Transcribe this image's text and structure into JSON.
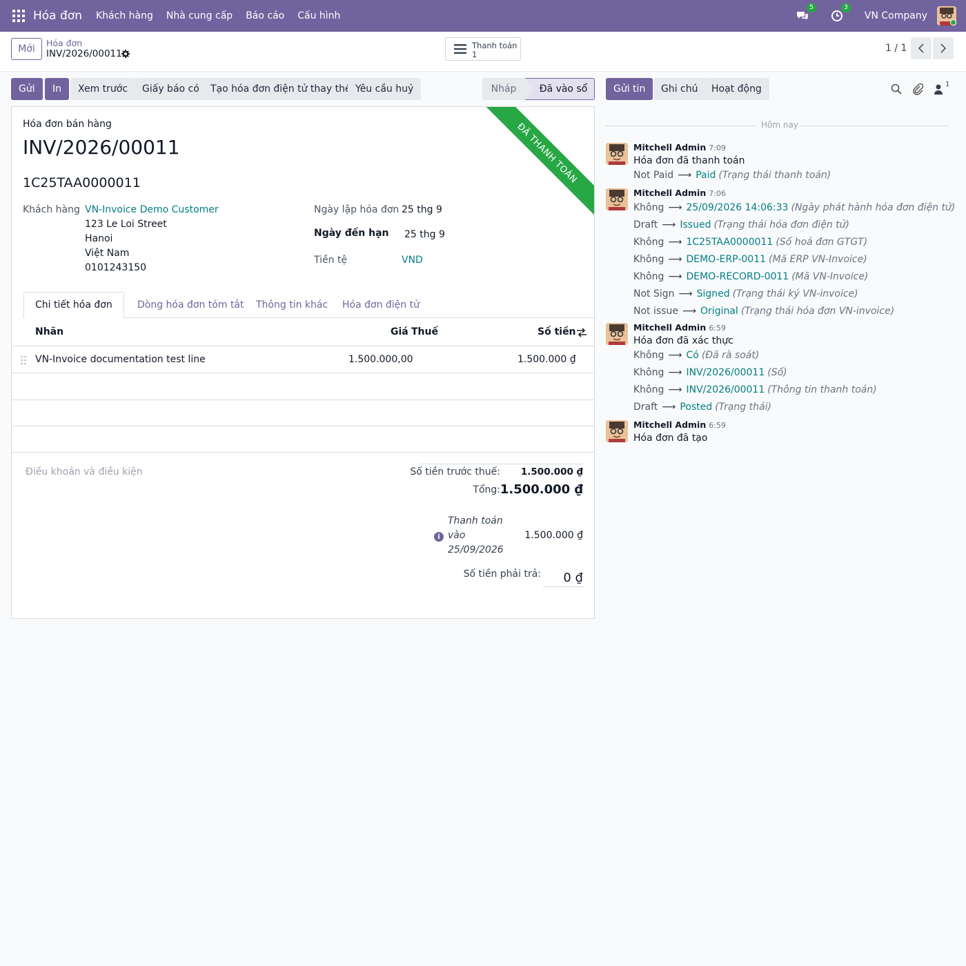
{
  "navbar": {
    "app_name": "Hóa đơn",
    "menu": [
      "Khách hàng",
      "Nhà cung cấp",
      "Báo cáo",
      "Cấu hình"
    ],
    "messages_badge": "5",
    "activities_badge": "3",
    "company": "VN Company",
    "accent": "#71639e"
  },
  "control_panel": {
    "new_label": "Mới",
    "breadcrumb_parent": "Hóa đơn",
    "breadcrumb_current": "INV/2026/00011",
    "smart_button_label": "Thanh toán",
    "smart_button_value": "1",
    "pager": "1 / 1"
  },
  "actions": {
    "send": "Gửi",
    "print": "In",
    "preview": "Xem trước",
    "credit_note": "Giấy báo có",
    "replace_einvoice": "Tạo hóa đơn điện tử thay thế",
    "request_cancel": "Yêu cầu huỷ"
  },
  "status": {
    "draft": "Nháp",
    "posted": "Đã vào sổ"
  },
  "form": {
    "ribbon": "ĐÃ THANH TOÁN",
    "doc_type": "Hóa đơn bán hàng",
    "name": "INV/2026/00011",
    "einvoice_number": "1C25TAA0000011",
    "customer_label": "Khách hàng",
    "customer_name": "VN-Invoice Demo Customer",
    "customer_address": [
      "123 Le Loi Street",
      "Hanoi",
      "Việt Nam",
      "0101243150"
    ],
    "invoice_date_label": "Ngày lập hóa đơn",
    "invoice_date": "25 thg 9",
    "due_date_label": "Ngày đến hạn",
    "due_date": "25 thg 9",
    "currency_label": "Tiền tệ",
    "currency": "VND"
  },
  "tabs": [
    "Chi tiết hóa đơn",
    "Dòng hóa đơn tóm tắt",
    "Thông tin khác",
    "Hóa đơn điện tử"
  ],
  "lines_table": {
    "headers": {
      "label": "Nhãn",
      "price": "Giá",
      "tax": "Thuế",
      "amount": "Số tiền"
    },
    "rows": [
      {
        "label": "VN-Invoice documentation test line",
        "price": "1.500.000,00",
        "tax": "",
        "amount": "1.500.000 ₫"
      }
    ]
  },
  "totals": {
    "terms_placeholder": "Điều khoản và điều kiện",
    "untaxed_label": "Số tiền trước thuế:",
    "untaxed_value": "1.500.000 ₫",
    "total_label": "Tổng:",
    "total_value": "1.500.000 ₫",
    "payment_lines": [
      "Thanh toán",
      "vào",
      "25/09/2026"
    ],
    "payment_value": "1.500.000 ₫",
    "residual_label": "Số tiền phải trả:",
    "residual_value": "0 ₫"
  },
  "chatter": {
    "send_message": "Gửi tin",
    "log_note": "Ghi chú",
    "activities": "Hoạt động",
    "followers_count": "1",
    "today": "Hôm nay",
    "messages": [
      {
        "author": "Mitchell Admin",
        "time": "7:09",
        "body": "Hóa đơn đã thanh toán",
        "tracking": [
          {
            "old": "Not Paid",
            "new": "Paid",
            "field": "(Trạng thái thanh toán)"
          }
        ]
      },
      {
        "author": "Mitchell Admin",
        "time": "7:06",
        "body": "",
        "tracking": [
          {
            "old": "Không",
            "new": "25/09/2026 14:06:33",
            "field": "(Ngày phát hành hóa đơn điện tử)"
          },
          {
            "old": "Draft",
            "new": "Issued",
            "field": "(Trạng thái hóa đơn điện tử)"
          },
          {
            "old": "Không",
            "new": "1C25TAA0000011",
            "field": "(Số hoá đơn GTGT)"
          },
          {
            "old": "Không",
            "new": "DEMO-ERP-0011",
            "field": "(Mã ERP VN-Invoice)"
          },
          {
            "old": "Không",
            "new": "DEMO-RECORD-0011",
            "field": "(Mã VN-Invoice)"
          },
          {
            "old": "Not Sign",
            "new": "Signed",
            "field": "(Trạng thái ký VN-invoice)"
          },
          {
            "old": "Not issue",
            "new": "Original",
            "field": "(Trạng thái hóa đơn VN-invoice)"
          }
        ]
      },
      {
        "author": "Mitchell Admin",
        "time": "6:59",
        "body": "Hóa đơn đã xác thực",
        "tracking": [
          {
            "old": "Không",
            "new": "Có",
            "field": "(Đã rà soát)"
          },
          {
            "old": "Không",
            "new": "INV/2026/00011",
            "field": "(Số)"
          },
          {
            "old": "Không",
            "new": "INV/2026/00011",
            "field": "(Thông tin thanh toán)"
          },
          {
            "old": "Draft",
            "new": "Posted",
            "field": "(Trạng thái)"
          }
        ]
      },
      {
        "author": "Mitchell Admin",
        "time": "6:59",
        "body": "Hóa đơn đã tạo",
        "tracking": []
      }
    ]
  }
}
